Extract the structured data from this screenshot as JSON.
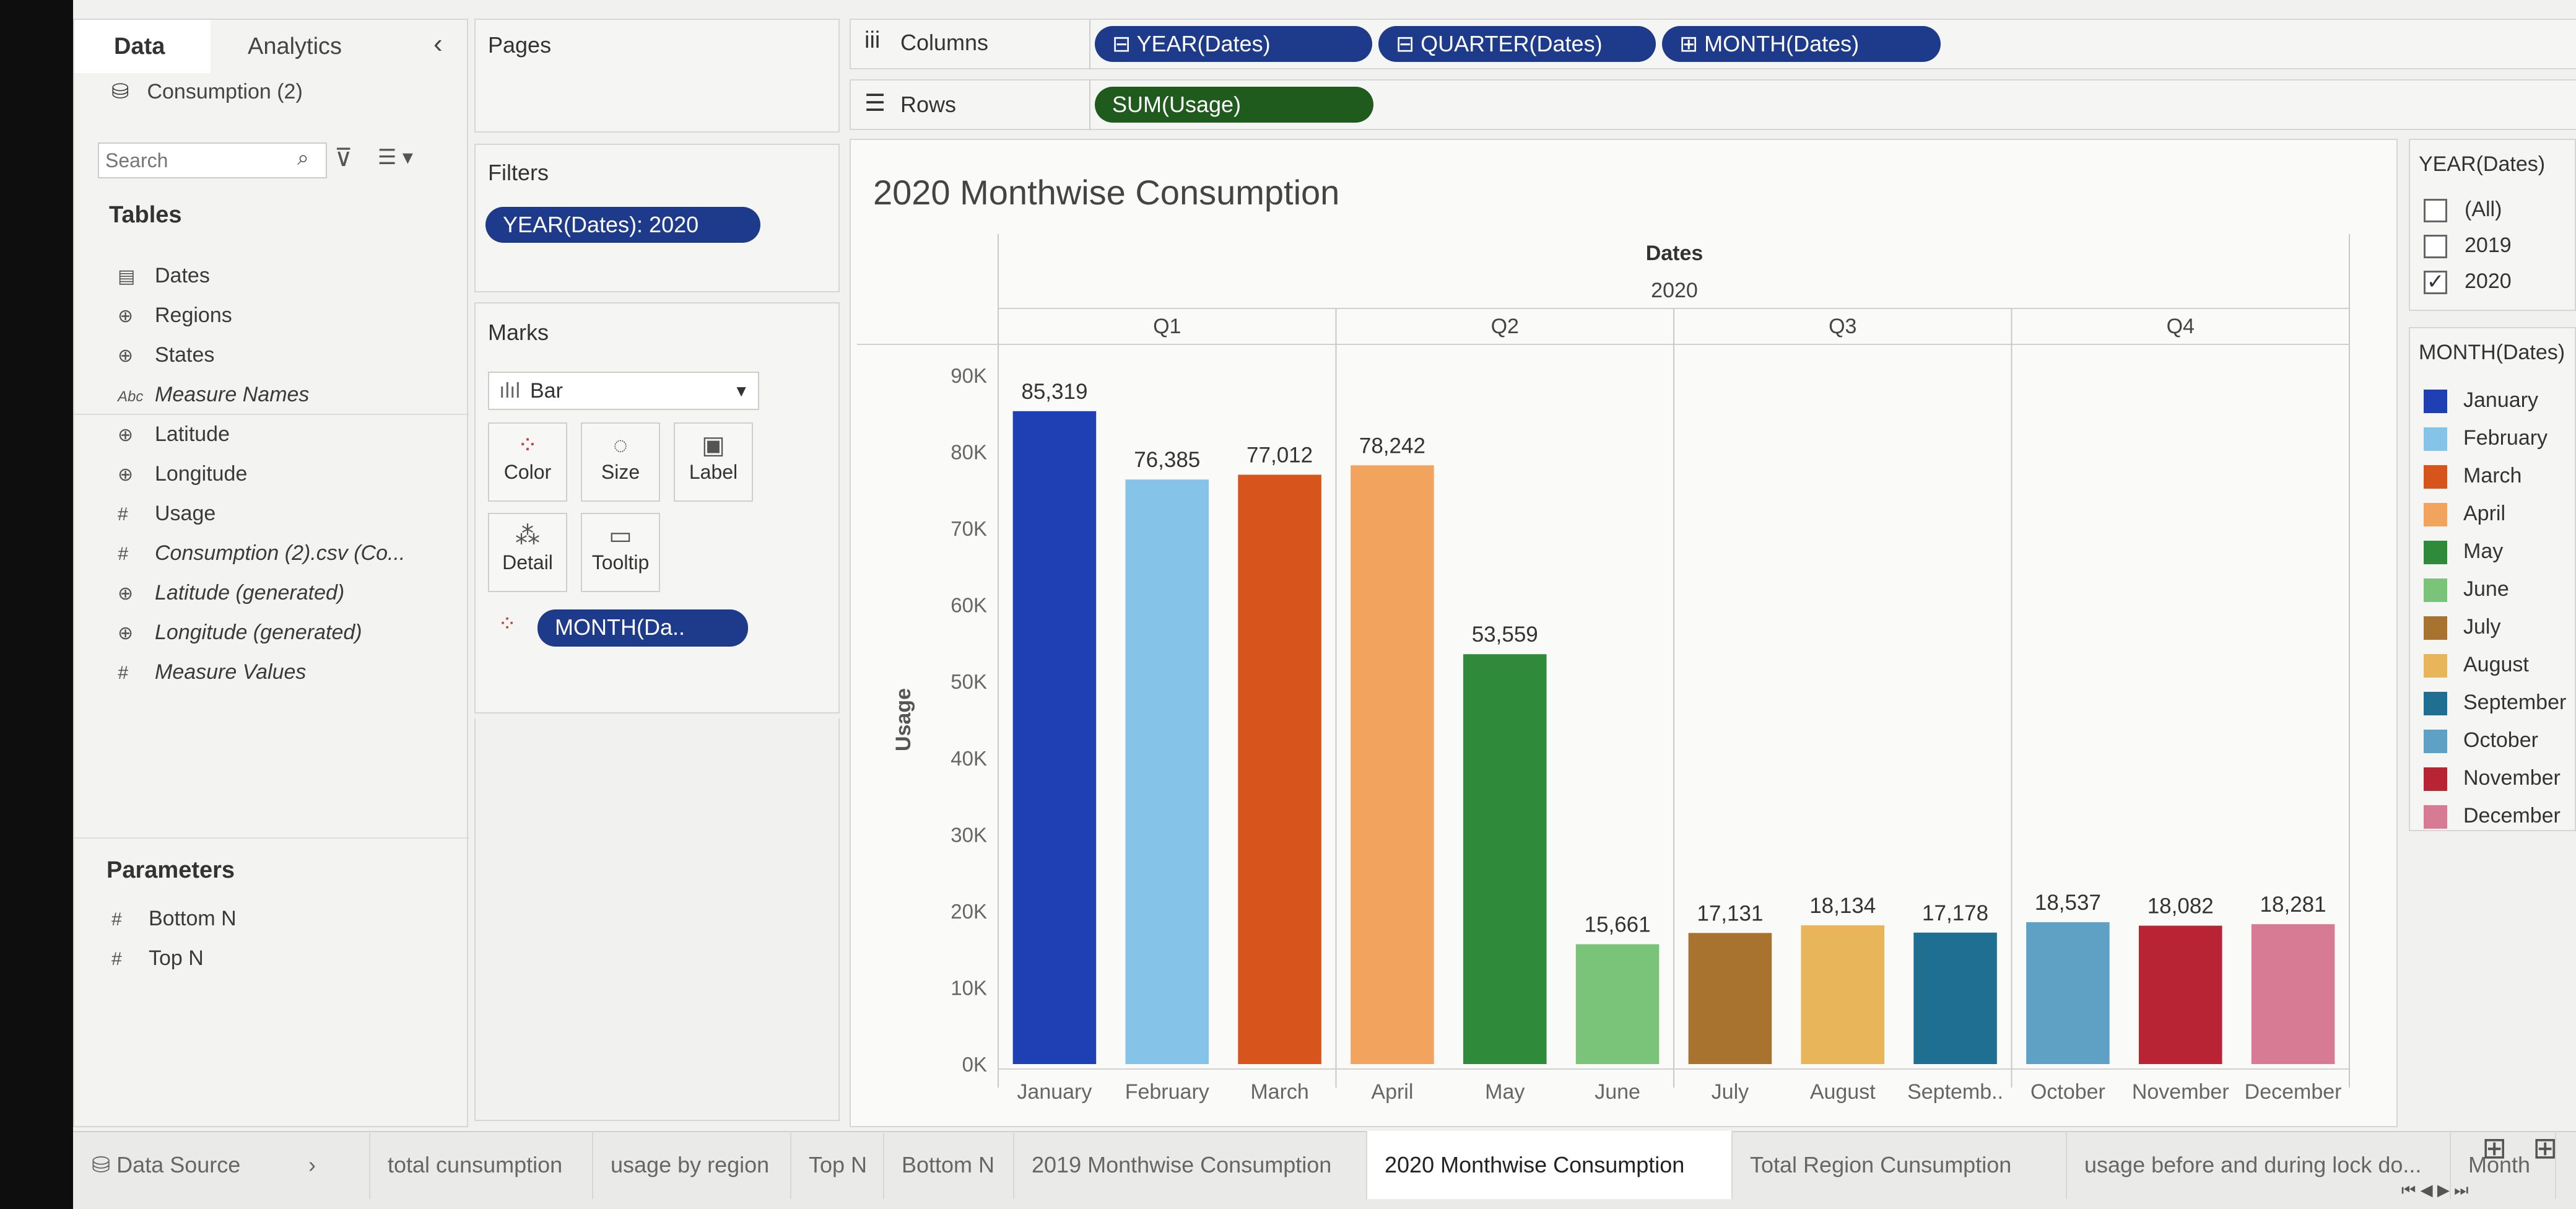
{
  "left_panel": {
    "tabs": [
      "Data",
      "Analytics"
    ],
    "datasource": "Consumption (2)",
    "search_placeholder": "Search",
    "tables_title": "Tables",
    "fields": [
      {
        "name": "Dates",
        "icon": "calendar-icon",
        "italic": false
      },
      {
        "name": "Regions",
        "icon": "globe-icon",
        "italic": false
      },
      {
        "name": "States",
        "icon": "globe-icon",
        "italic": false
      },
      {
        "name": "Measure Names",
        "icon": "abc-icon",
        "italic": true
      },
      {
        "name": "Latitude",
        "icon": "globe-icon",
        "italic": false
      },
      {
        "name": "Longitude",
        "icon": "globe-icon",
        "italic": false
      },
      {
        "name": "Usage",
        "icon": "hash-icon",
        "italic": false
      },
      {
        "name": "Consumption (2).csv (Co...",
        "icon": "hash-icon",
        "italic": true
      },
      {
        "name": "Latitude (generated)",
        "icon": "globe-icon",
        "italic": true
      },
      {
        "name": "Longitude (generated)",
        "icon": "globe-icon",
        "italic": true
      },
      {
        "name": "Measure Values",
        "icon": "hash-icon",
        "italic": true
      }
    ],
    "parameters_title": "Parameters",
    "parameters": [
      "Bottom N",
      "Top N"
    ]
  },
  "shelves": {
    "pages": "Pages",
    "filters": "Filters",
    "filter_pill": "YEAR(Dates): 2020",
    "marks": "Marks",
    "mark_type": "Bar",
    "mark_buttons": [
      "Color",
      "Size",
      "Label",
      "Detail",
      "Tooltip"
    ],
    "mark_pill": "MONTH(Da..",
    "columns_label": "Columns",
    "columns": [
      "YEAR(Dates)",
      "QUARTER(Dates)",
      "MONTH(Dates)"
    ],
    "rows_label": "Rows",
    "rows": [
      "SUM(Usage)"
    ]
  },
  "chart_data": {
    "type": "bar",
    "title": "2020 Monthwise Consumption",
    "header_top": "Dates",
    "header_year": "2020",
    "quarters": [
      "Q1",
      "Q2",
      "Q3",
      "Q4"
    ],
    "categories": [
      "January",
      "February",
      "March",
      "April",
      "May",
      "June",
      "July",
      "August",
      "September",
      "October",
      "November",
      "December"
    ],
    "category_tick_labels": [
      "January",
      "February",
      "March",
      "April",
      "May",
      "June",
      "July",
      "August",
      "Septemb..",
      "October",
      "November",
      "December"
    ],
    "values": [
      85319,
      76385,
      77012,
      78242,
      53559,
      15661,
      17131,
      18134,
      17178,
      18537,
      18082,
      18281
    ],
    "value_labels": [
      "85,319",
      "76,385",
      "77,012",
      "78,242",
      "53,559",
      "15,661",
      "17,131",
      "18,134",
      "17,178",
      "18,537",
      "18,082",
      "18,281"
    ],
    "colors": [
      "#1f3fb5",
      "#86c3e8",
      "#d8541d",
      "#f2a45e",
      "#2f8a3a",
      "#7ac47a",
      "#a8732e",
      "#e8b55a",
      "#1f6f92",
      "#5fa1c4",
      "#b82434",
      "#d67b93"
    ],
    "ylabel": "Usage",
    "ylim": [
      0,
      90000
    ],
    "yticks": [
      0,
      10000,
      20000,
      30000,
      40000,
      50000,
      60000,
      70000,
      80000,
      90000
    ],
    "ytick_labels": [
      "0K",
      "10K",
      "20K",
      "30K",
      "40K",
      "50K",
      "60K",
      "70K",
      "80K",
      "90K"
    ],
    "grid": false
  },
  "legends": {
    "year_title": "YEAR(Dates)",
    "year_options": [
      {
        "label": "(All)",
        "checked": false
      },
      {
        "label": "2019",
        "checked": false
      },
      {
        "label": "2020",
        "checked": true
      }
    ],
    "month_title": "MONTH(Dates)",
    "months": [
      "January",
      "February",
      "March",
      "April",
      "May",
      "June",
      "July",
      "August",
      "September",
      "October",
      "November",
      "December"
    ]
  },
  "bottom_tabs": {
    "data_source": "Data Source",
    "sheets": [
      "total cunsumption",
      "usage by region",
      "Top N",
      "Bottom N",
      "2019 Monthwise Consumption",
      "2020 Monthwise Consumption",
      "Total Region Cunsumption",
      "usage before and during lock do...",
      "Month"
    ],
    "active_index": 5
  }
}
